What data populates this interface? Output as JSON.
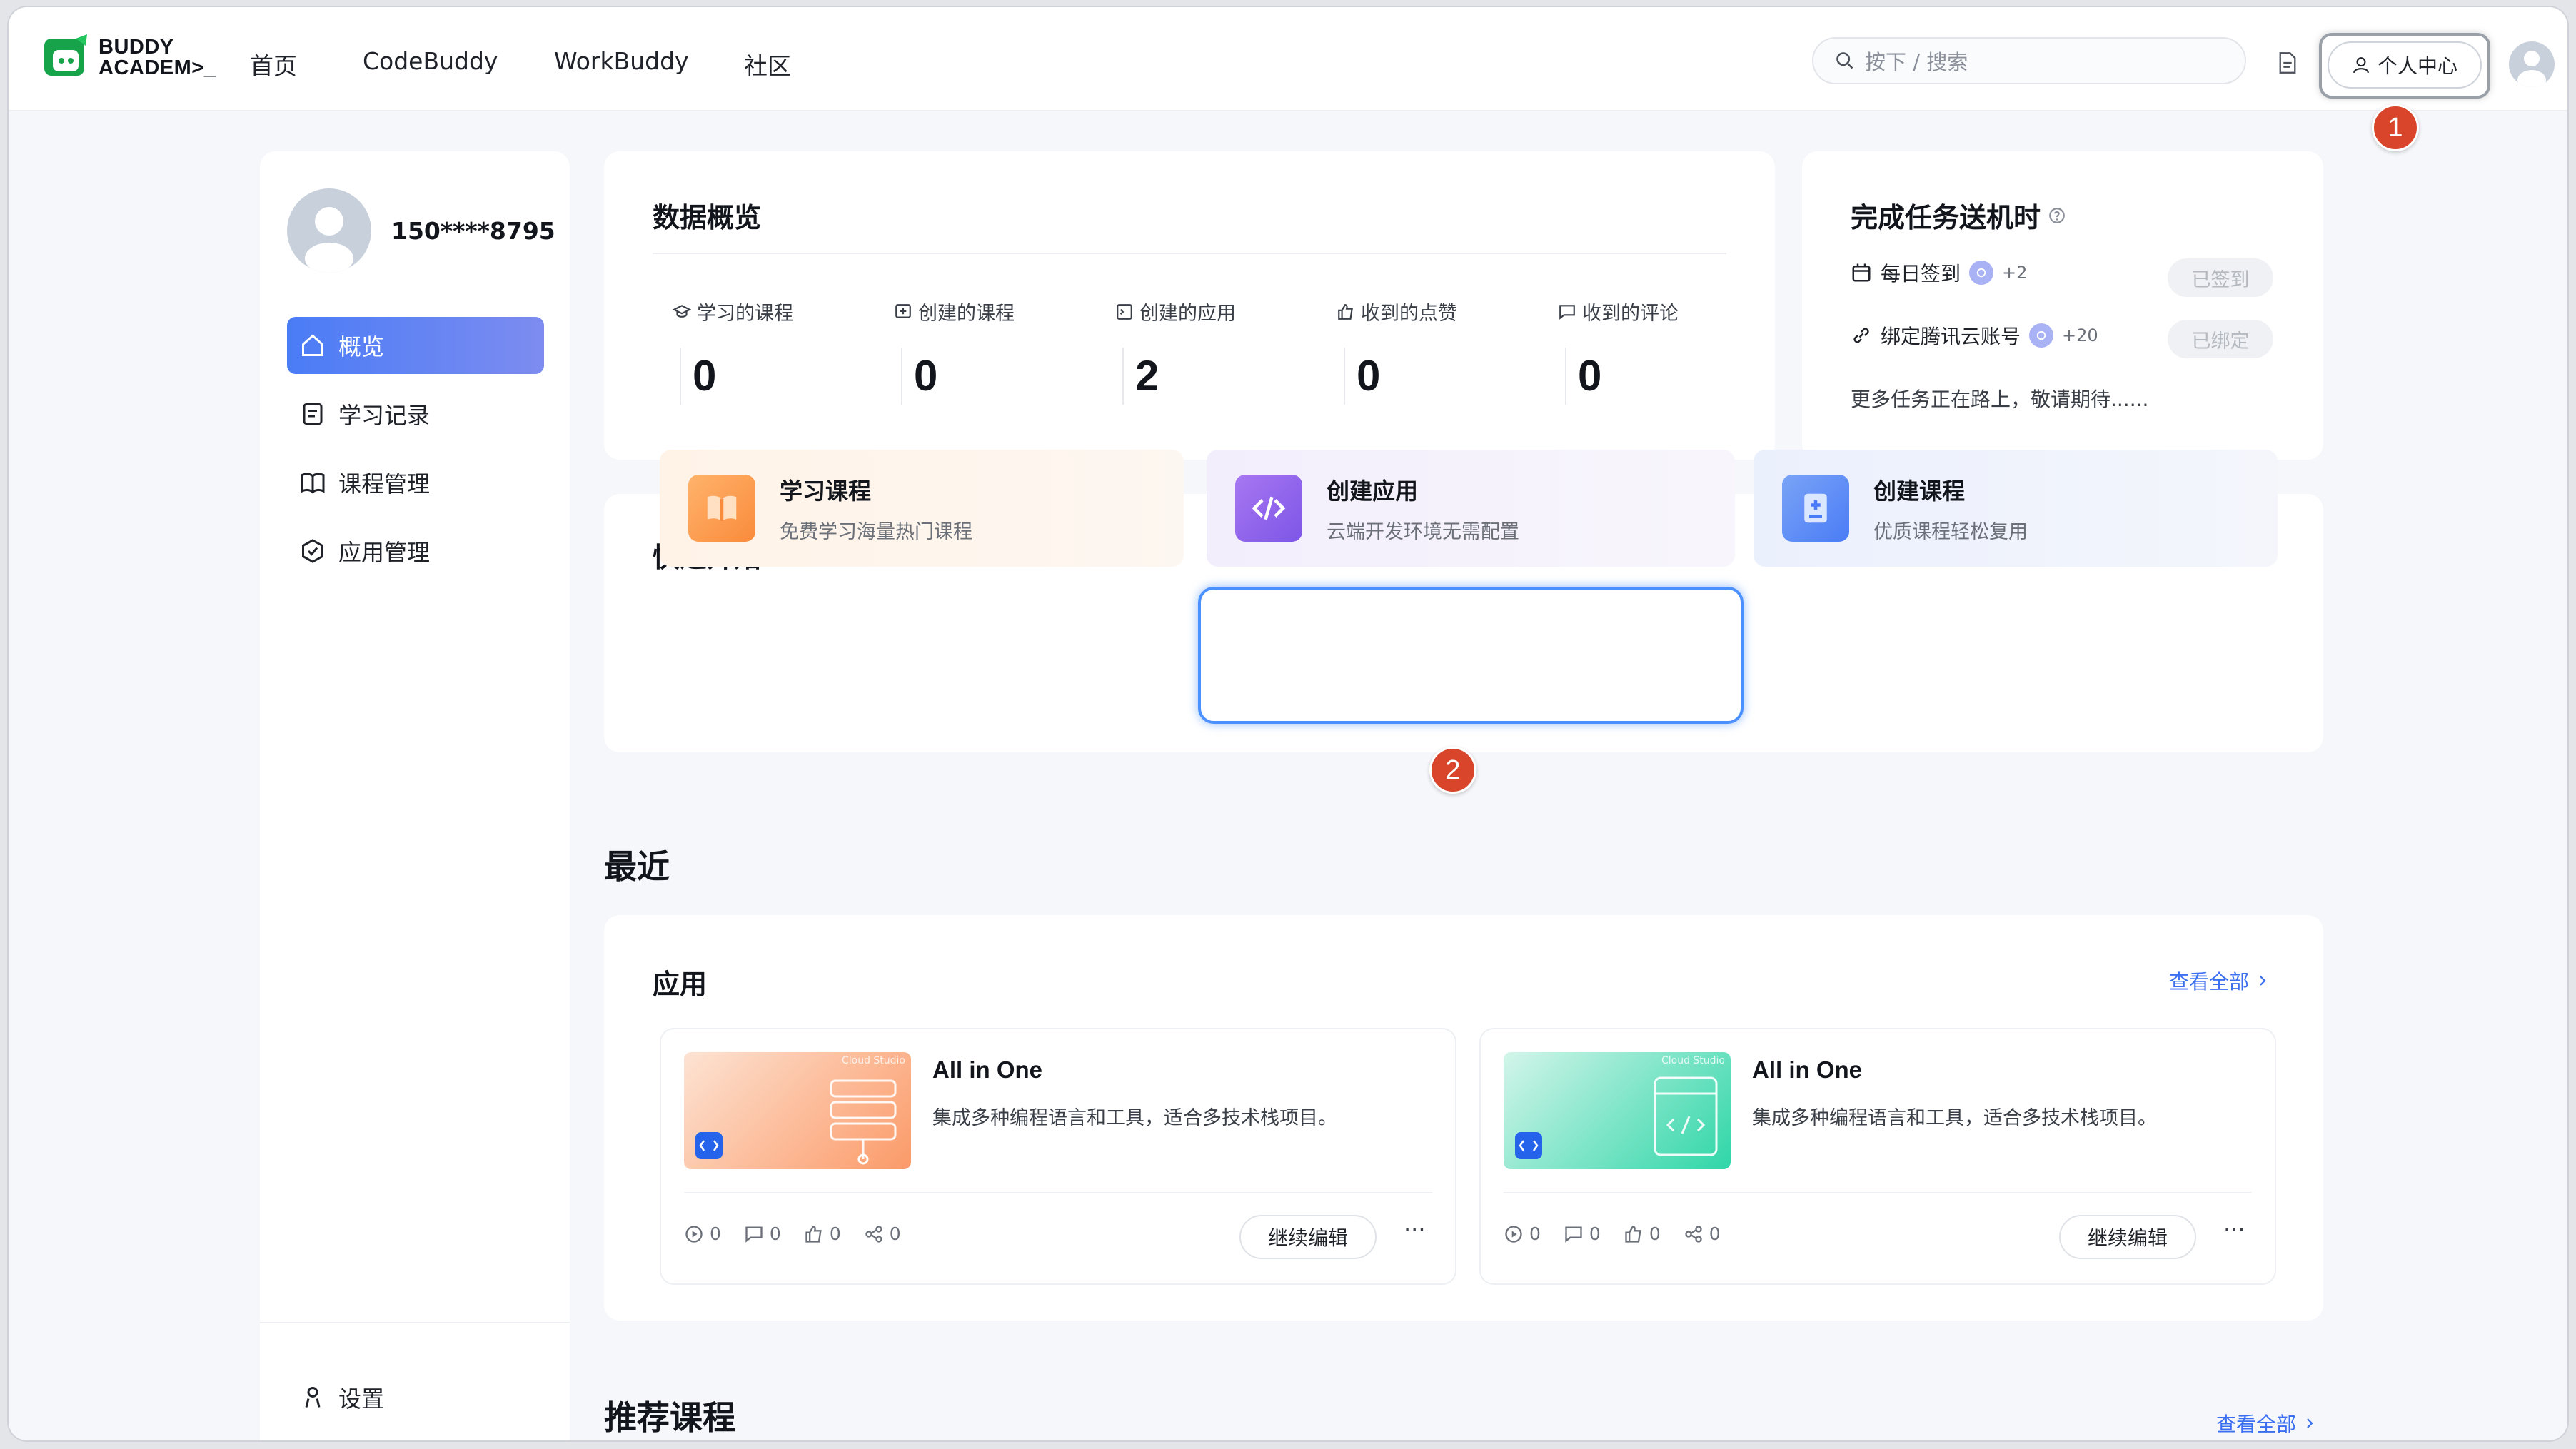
{
  "nav": {
    "logo_line1": "BUDDY",
    "logo_line2": "ACADEM>_",
    "links": [
      "首页",
      "CodeBuddy",
      "WorkBuddy",
      "社区"
    ],
    "search_placeholder": "按下 /  搜索",
    "user_center": "个人中心"
  },
  "badges": [
    "1",
    "2"
  ],
  "sidebar": {
    "phone": "150****8795",
    "items": [
      {
        "label": "概览",
        "icon": "home-icon",
        "active": true
      },
      {
        "label": "学习记录",
        "icon": "record-icon",
        "active": false
      },
      {
        "label": "课程管理",
        "icon": "book-icon",
        "active": false
      },
      {
        "label": "应用管理",
        "icon": "app-icon",
        "active": false
      }
    ],
    "settings": "设置"
  },
  "overview": {
    "title": "数据概览",
    "stats": [
      {
        "label": "学习的课程",
        "value": "0"
      },
      {
        "label": "创建的课程",
        "value": "0"
      },
      {
        "label": "创建的应用",
        "value": "2"
      },
      {
        "label": "收到的点赞",
        "value": "0"
      },
      {
        "label": "收到的评论",
        "value": "0"
      }
    ]
  },
  "tasks": {
    "title": "完成任务送机时",
    "items": [
      {
        "label": "每日签到",
        "points": "+2",
        "status": "已签到"
      },
      {
        "label": "绑定腾讯云账号",
        "points": "+20",
        "status": "已绑定"
      }
    ],
    "more": "更多任务正在路上，敬请期待......"
  },
  "quick_start": {
    "title": "快速开始",
    "tiles": [
      {
        "title": "学习课程",
        "subtitle": "免费学习海量热门课程"
      },
      {
        "title": "创建应用",
        "subtitle": "云端开发环境无需配置"
      },
      {
        "title": "创建课程",
        "subtitle": "优质课程轻松复用"
      }
    ]
  },
  "recent": {
    "title": "最近",
    "apps_title": "应用",
    "view_all": "查看全部",
    "apps": [
      {
        "name": "All in One",
        "desc": "集成多种编程语言和工具，适合多技术栈项目。",
        "plays": "0",
        "comments": "0",
        "likes": "0",
        "shares": "0",
        "action": "继续编辑",
        "thumb_label": "Cloud Studio"
      },
      {
        "name": "All in One",
        "desc": "集成多种编程语言和工具，适合多技术栈项目。",
        "plays": "0",
        "comments": "0",
        "likes": "0",
        "shares": "0",
        "action": "继续编辑",
        "thumb_label": "Cloud Studio"
      }
    ],
    "more_label": "···"
  },
  "recommended": {
    "title": "推荐课程",
    "view_all": "查看全部"
  },
  "colors": {
    "accent": "#4a7cf6",
    "badge": "#d9452b",
    "link": "#3b6ff0",
    "highlight_ring": "#4a90ff"
  }
}
